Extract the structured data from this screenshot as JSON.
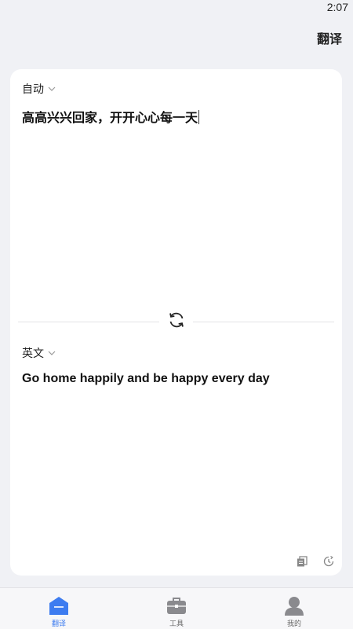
{
  "status_bar": {
    "time": "2:07"
  },
  "header": {
    "title": "翻译"
  },
  "source": {
    "language": "自动",
    "text": "高高兴兴回家，开开心心每一天"
  },
  "target": {
    "language": "英文",
    "text": "Go home happily and be happy every day"
  },
  "icons": {
    "swap": "swap-icon",
    "copy": "copy-icon",
    "history": "history-icon"
  },
  "tabs": [
    {
      "label": "翻译",
      "icon": "home-icon",
      "active": true
    },
    {
      "label": "工具",
      "icon": "toolbox-icon",
      "active": false
    },
    {
      "label": "我的",
      "icon": "user-icon",
      "active": false
    }
  ],
  "colors": {
    "accent": "#3d7cf0",
    "background": "#f0f1f5",
    "card": "#ffffff"
  }
}
